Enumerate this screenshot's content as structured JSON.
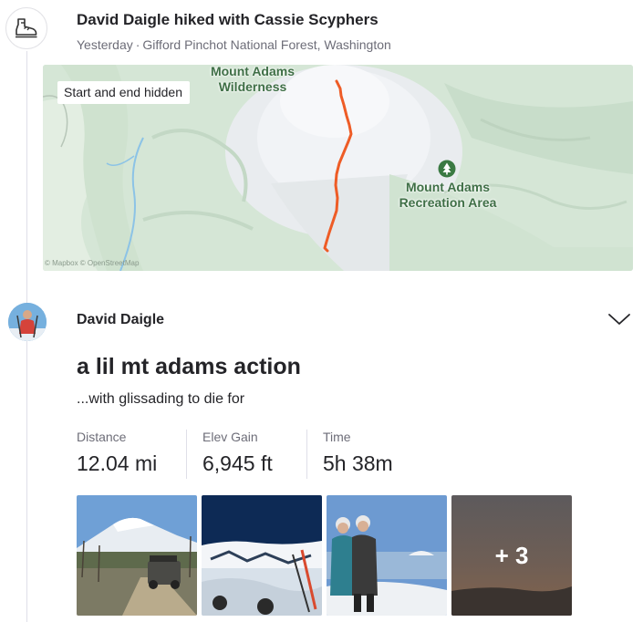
{
  "activity": {
    "icon": "hiking-boot-icon",
    "title": "David Daigle hiked with Cassie Scyphers",
    "when": "Yesterday",
    "separator": "·",
    "location": "Gifford Pinchot National Forest, Washington"
  },
  "map": {
    "hidden_badge": "Start and end hidden",
    "label_wilderness": "Mount Adams Wilderness",
    "label_recreation": "Mount Adams Recreation Area",
    "recreation_icon": "tree-icon",
    "attribution": "© Mapbox © OpenStreetMap",
    "route_color": "#ee5c26"
  },
  "post": {
    "author": "David Daigle",
    "menu_icon": "chevron-down-icon",
    "title": "a lil mt adams action",
    "description": "...with glissading to die for"
  },
  "stats": [
    {
      "label": "Distance",
      "value": "12.04 mi"
    },
    {
      "label": "Elev Gain",
      "value": "6,945 ft"
    },
    {
      "label": "Time",
      "value": "5h 38m"
    }
  ],
  "photos": {
    "more_count": "+ 3"
  }
}
